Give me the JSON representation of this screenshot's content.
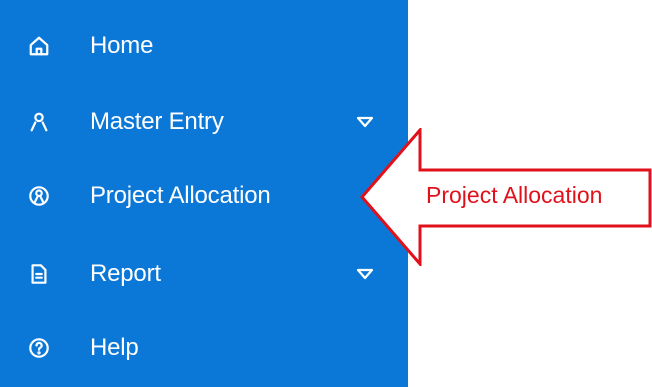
{
  "sidebar": {
    "background_color": "#0b78d8",
    "items": [
      {
        "label": "Home",
        "icon": "home-icon",
        "has_submenu": false
      },
      {
        "label": "Master Entry",
        "icon": "user-icon",
        "has_submenu": true
      },
      {
        "label": "Project Allocation",
        "icon": "user-circle-icon",
        "has_submenu": false
      },
      {
        "label": "Report",
        "icon": "document-icon",
        "has_submenu": true
      },
      {
        "label": "Help",
        "icon": "help-icon",
        "has_submenu": false
      }
    ]
  },
  "annotation": {
    "text": "Project Allocation",
    "color": "#e1111b",
    "arrow_color": "#e1111b",
    "points_to": "Project Allocation"
  }
}
